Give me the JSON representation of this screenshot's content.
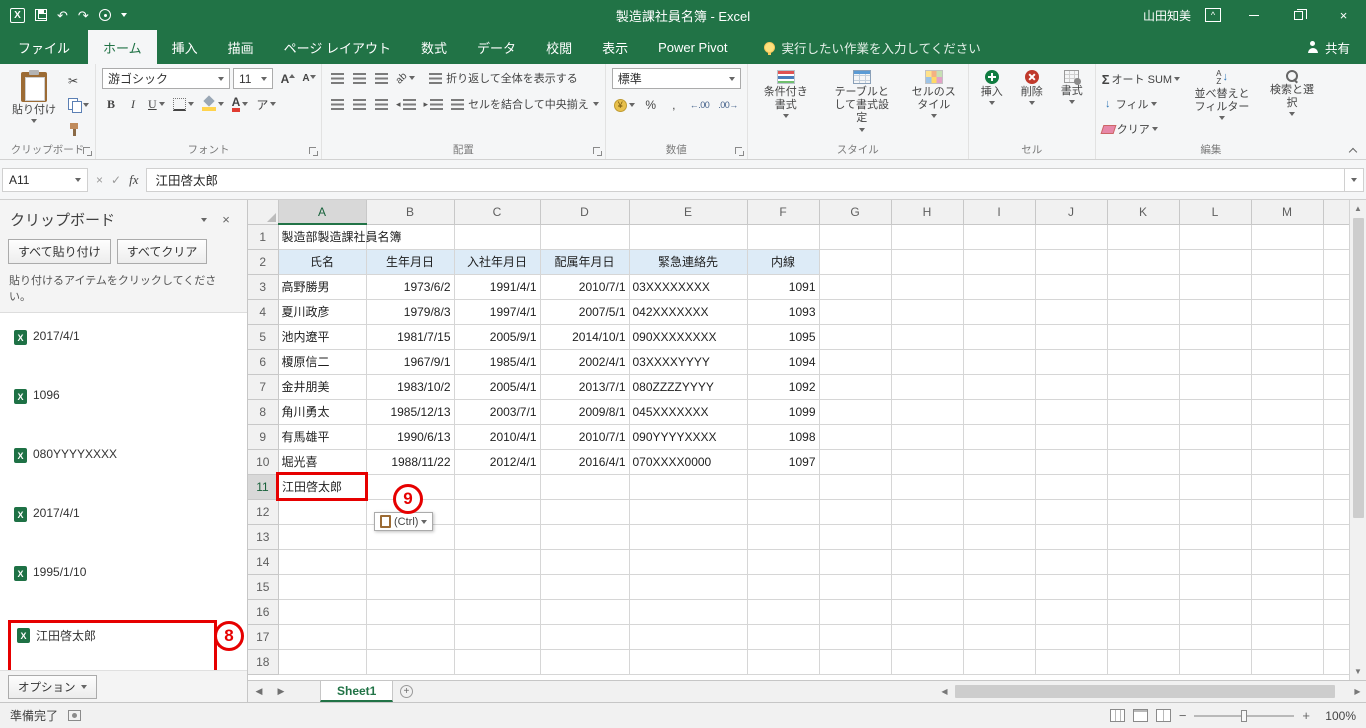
{
  "title_bar": {
    "title": "製造課社員名簿 - Excel",
    "user": "山田知美"
  },
  "ribbon_tabs": {
    "file": "ファイル",
    "tabs": [
      "ホーム",
      "挿入",
      "描画",
      "ページ レイアウト",
      "数式",
      "データ",
      "校閲",
      "表示",
      "Power Pivot"
    ],
    "active_tab": "ホーム",
    "tell_me": "実行したい作業を入力してください",
    "share": "共有"
  },
  "ribbon": {
    "clipboard": {
      "label": "クリップボード",
      "paste": "貼り付け"
    },
    "font": {
      "label": "フォント",
      "font_name": "游ゴシック",
      "font_size": "11",
      "bold": "B",
      "italic": "I",
      "underline": "U",
      "phonetic": "ア"
    },
    "alignment": {
      "label": "配置",
      "wrap_text": "折り返して全体を表示する",
      "merge_center": "セルを結合して中央揃え"
    },
    "number": {
      "label": "数値",
      "format": "標準",
      "currency": "¥",
      "percent": "%",
      "comma": ",",
      "inc_decimal": "←.00",
      "dec_decimal": ".00→"
    },
    "styles": {
      "label": "スタイル",
      "conditional": "条件付き書式",
      "format_as_table": "テーブルとして書式設定",
      "cell_styles": "セルのスタイル"
    },
    "cells": {
      "label": "セル",
      "insert": "挿入",
      "delete": "削除",
      "format": "書式"
    },
    "editing": {
      "label": "編集",
      "autosum": "オート SUM",
      "fill": "フィル",
      "clear": "クリア",
      "sort_filter": "並べ替えとフィルター",
      "find_select": "検索と選択"
    }
  },
  "formula_bar": {
    "name_box": "A11",
    "fx": "fx",
    "value": "江田啓太郎"
  },
  "clipboard_pane": {
    "title": "クリップボード",
    "paste_all": "すべて貼り付け",
    "clear_all": "すべてクリア",
    "hint": "貼り付けるアイテムをクリックしてください。",
    "items": [
      "2017/4/1",
      "1096",
      "080YYYYXXXX",
      "2017/4/1",
      "1995/1/10",
      "江田啓太郎"
    ],
    "highlighted_item_index": 5,
    "options": "オプション"
  },
  "sheet": {
    "columns": [
      "A",
      "B",
      "C",
      "D",
      "E",
      "F",
      "G",
      "H",
      "I",
      "J",
      "K",
      "L",
      "M"
    ],
    "row_count": 18,
    "active_column": "A",
    "active_row": 11,
    "cells": {
      "A1": "製造部製造課社員名簿",
      "header_row": [
        "氏名",
        "生年月日",
        "入社年月日",
        "配属年月日",
        "緊急連絡先",
        "内線"
      ],
      "data_rows": [
        [
          "高野勝男",
          "1973/6/2",
          "1991/4/1",
          "2010/7/1",
          "03XXXXXXXX",
          "1091"
        ],
        [
          "夏川政彦",
          "1979/8/3",
          "1997/4/1",
          "2007/5/1",
          "042XXXXXXX",
          "1093"
        ],
        [
          "池内遼平",
          "1981/7/15",
          "2005/9/1",
          "2014/10/1",
          "090XXXXXXXX",
          "1095"
        ],
        [
          "榎原信二",
          "1967/9/1",
          "1985/4/1",
          "2002/4/1",
          "03XXXXYYYY",
          "1094"
        ],
        [
          "金井朋美",
          "1983/10/2",
          "2005/4/1",
          "2013/7/1",
          "080ZZZZYYYY",
          "1092"
        ],
        [
          "角川勇太",
          "1985/12/13",
          "2003/7/1",
          "2009/8/1",
          "045XXXXXXX",
          "1099"
        ],
        [
          "有馬雄平",
          "1990/6/13",
          "2010/4/1",
          "2010/7/1",
          "090YYYYXXXX",
          "1098"
        ],
        [
          "堀光喜",
          "1988/11/22",
          "2012/4/1",
          "2016/4/1",
          "070XXXX0000",
          "1097"
        ]
      ],
      "A11": "江田啓太郎"
    },
    "paste_options_label": "(Ctrl)"
  },
  "annotations": {
    "clipboard_item_badge": "8",
    "paste_options_badge": "9"
  },
  "sheet_tabs": {
    "active": "Sheet1"
  },
  "status_bar": {
    "mode": "準備完了",
    "zoom": "100%"
  },
  "colors": {
    "brand_green": "#217346",
    "table_header_fill": "#DDEBF7",
    "annotation_red": "#E60000"
  }
}
